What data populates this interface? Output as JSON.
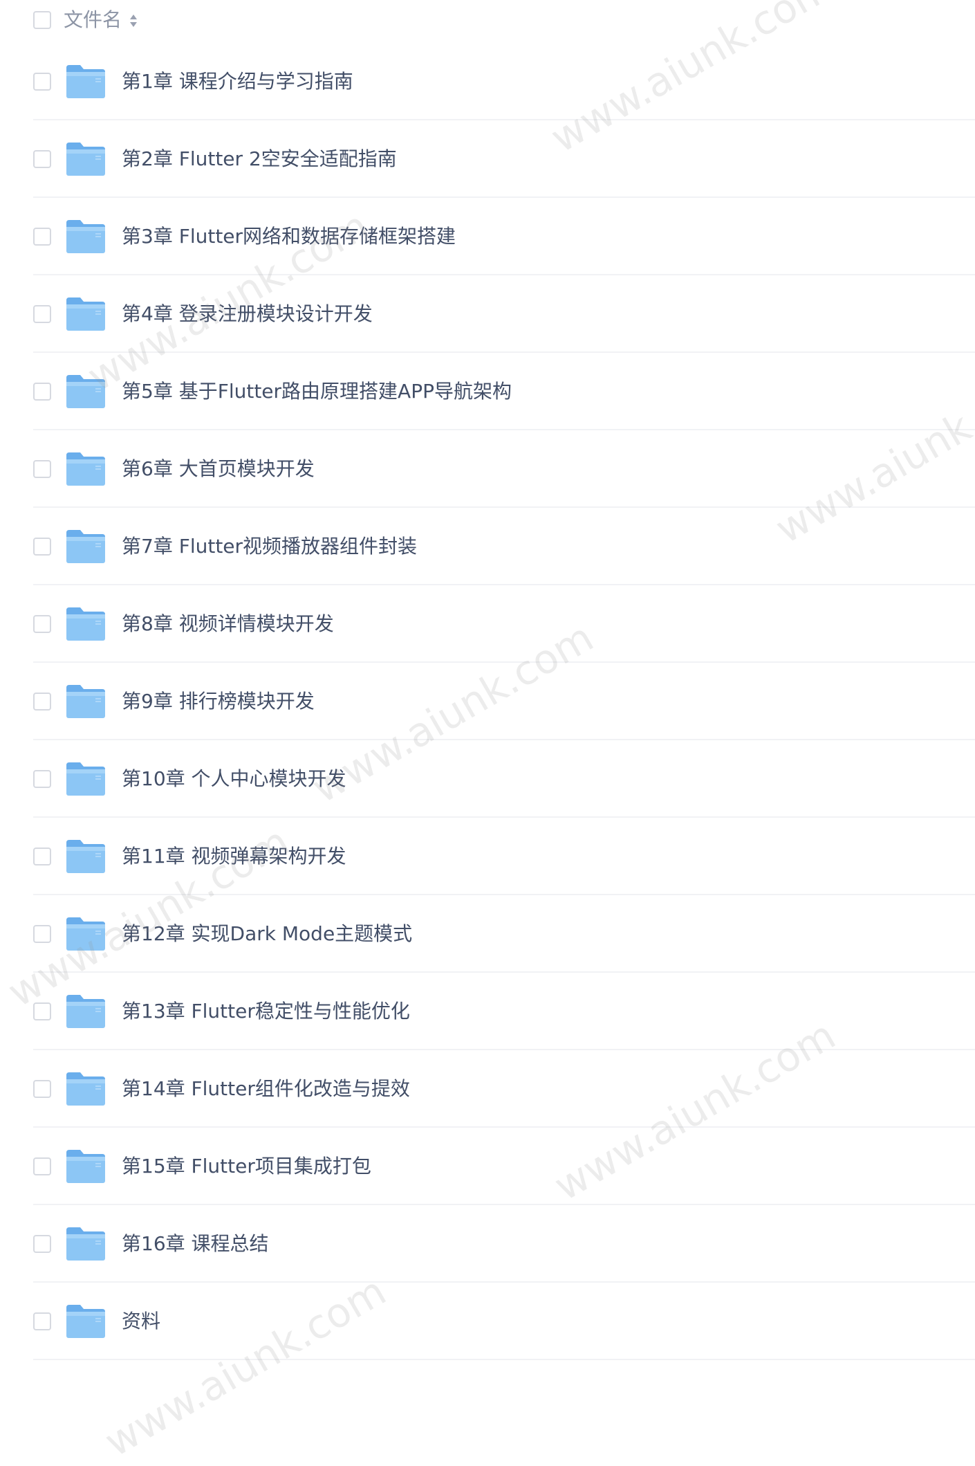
{
  "header": {
    "name_label": "文件名",
    "sort_icon": "sort-icon"
  },
  "icons": {
    "checkbox": "checkbox-icon",
    "folder": "folder-icon"
  },
  "colors": {
    "text": "#424e67",
    "header_text": "#8c94a5",
    "folder_body": "#8cc6f5",
    "folder_tab": "#6aaeec",
    "divider": "#f1f2f5",
    "checkbox_border": "#d6d9e0"
  },
  "rows": [
    {
      "name": "第1章 课程介绍与学习指南"
    },
    {
      "name": "第2章 Flutter 2空安全适配指南"
    },
    {
      "name": "第3章 Flutter网络和数据存储框架搭建"
    },
    {
      "name": "第4章 登录注册模块设计开发"
    },
    {
      "name": "第5章 基于Flutter路由原理搭建APP导航架构"
    },
    {
      "name": "第6章 大首页模块开发"
    },
    {
      "name": "第7章 Flutter视频播放器组件封装"
    },
    {
      "name": "第8章 视频详情模块开发"
    },
    {
      "name": "第9章 排行榜模块开发"
    },
    {
      "name": "第10章 个人中心模块开发"
    },
    {
      "name": "第11章 视频弹幕架构开发"
    },
    {
      "name": "第12章 实现Dark Mode主题模式"
    },
    {
      "name": "第13章 Flutter稳定性与性能优化"
    },
    {
      "name": "第14章 Flutter组件化改造与提效"
    },
    {
      "name": "第15章 Flutter项目集成打包"
    },
    {
      "name": "第16章 课程总结"
    },
    {
      "name": "资料"
    }
  ],
  "watermarks": [
    {
      "text": "www.aiunk.com"
    },
    {
      "text": "www.aiunk.com"
    },
    {
      "text": "www.aiunk.com"
    },
    {
      "text": "www.aiunk.com"
    },
    {
      "text": "www.aiunk.com"
    },
    {
      "text": "www.aiunk.com"
    },
    {
      "text": "www.aiunk.com"
    }
  ]
}
